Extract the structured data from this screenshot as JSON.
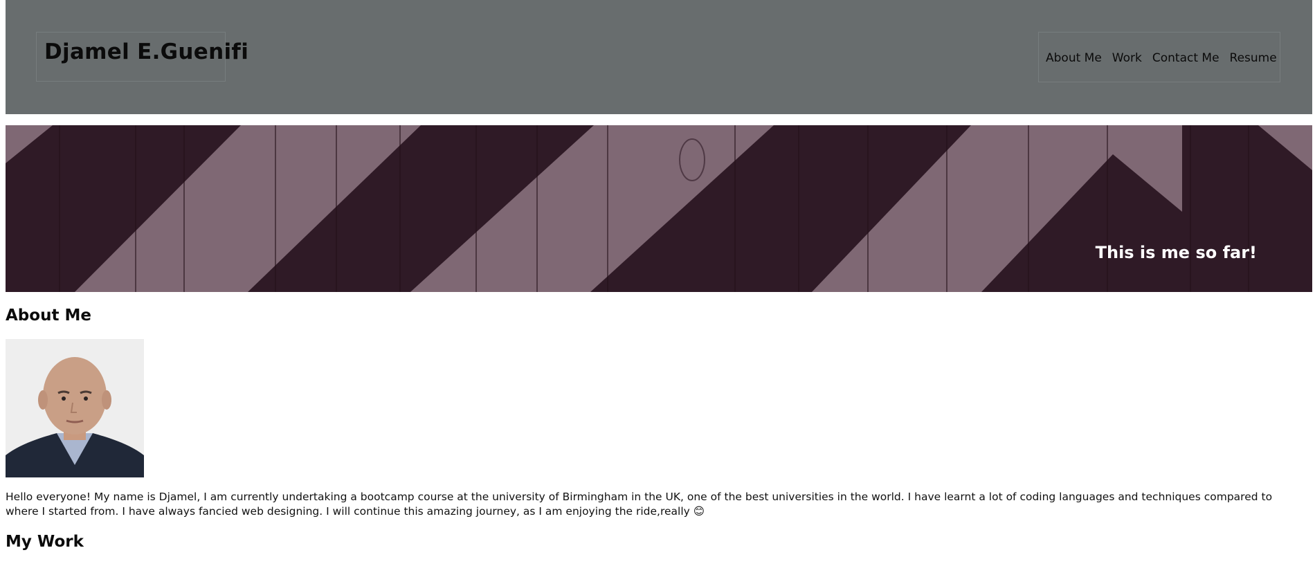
{
  "header": {
    "brand_title": "Djamel E.Guenifi",
    "background_color": "#686d6e",
    "nav": [
      {
        "label": "About Me"
      },
      {
        "label": "Work"
      },
      {
        "label": "Contact Me"
      },
      {
        "label": "Resume"
      }
    ]
  },
  "hero": {
    "caption": "This is me so far!",
    "dark_color": "#2f1a26",
    "light_color": "#7f6874"
  },
  "about": {
    "heading": "About Me",
    "bio": "Hello everyone! My name is Djamel, I am currently undertaking a bootcamp course at the university of Birmingham in the UK, one of the best universities in the world. I have learnt a lot of coding languages and techniques compared to where I started from. I have always fancied web designing. I will continue this amazing journey, as I am enjoying the ride,really 😊"
  },
  "work": {
    "heading": "My Work"
  }
}
